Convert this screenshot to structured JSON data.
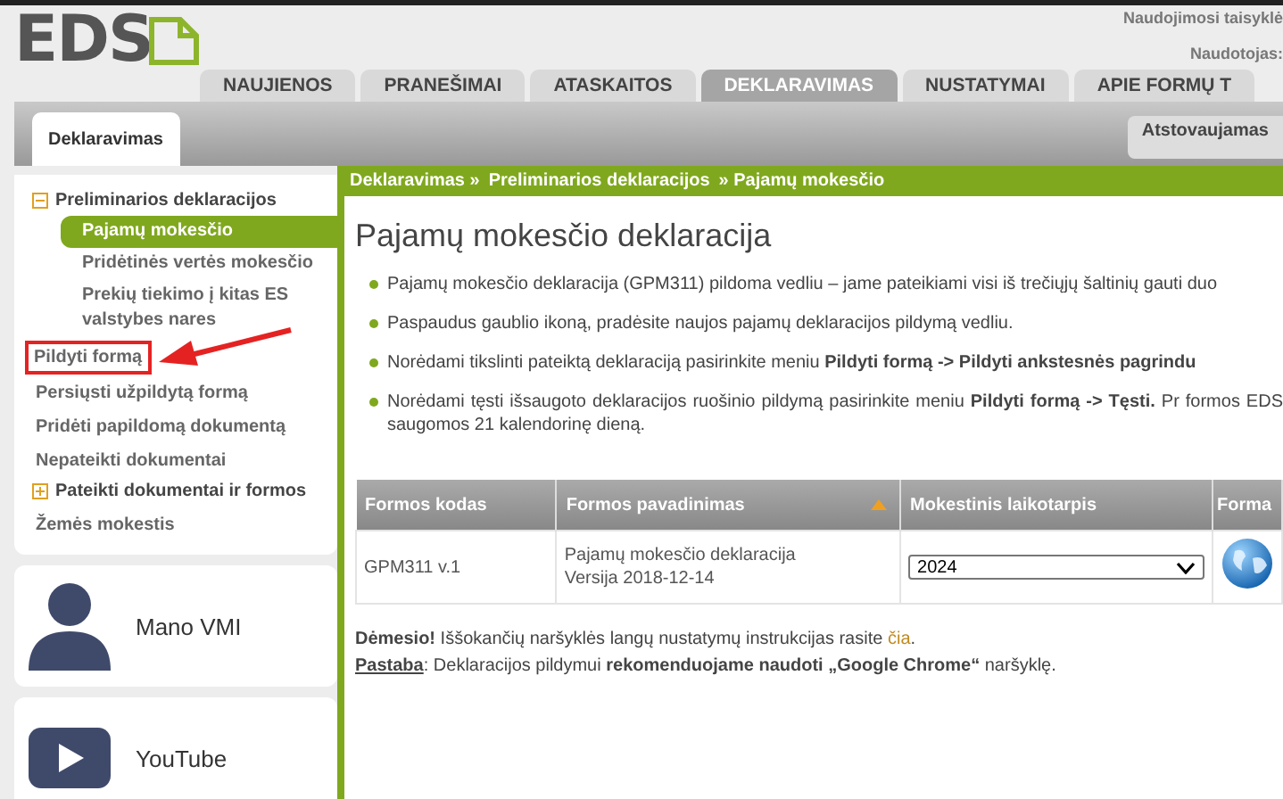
{
  "header": {
    "logo": "EDS",
    "links": [
      "Naudojimosi taisyklė",
      "Naudotojas:"
    ]
  },
  "tabs": [
    {
      "label": "NAUJIENOS",
      "selected": false
    },
    {
      "label": "PRANEŠIMAI",
      "selected": false
    },
    {
      "label": "ATASKAITOS",
      "selected": false
    },
    {
      "label": "DEKLARAVIMAS",
      "selected": true
    },
    {
      "label": "NUSTATYMAI",
      "selected": false
    },
    {
      "label": "APIE FORMŲ T",
      "selected": false
    }
  ],
  "subtabs": [
    {
      "label": "Deklaravimas",
      "selected": true
    }
  ],
  "represented": "Atstovaujamas",
  "sidebar": {
    "items": [
      {
        "label": "Preliminarios deklaracijos",
        "kind": "group",
        "expanded": true,
        "children": [
          {
            "label": "Pajamų mokesčio",
            "selected": true
          },
          {
            "label": "Pridėtinės vertės mokesčio",
            "selected": false
          },
          {
            "label": "Prekių tiekimo į kitas ES valstybes nares",
            "selected": false
          }
        ]
      },
      {
        "label": "Pildyti formą",
        "kind": "item",
        "annotated": true
      },
      {
        "label": "Persiųsti užpildytą formą",
        "kind": "item",
        "annotated": false
      },
      {
        "label": "Pridėti papildomą dokumentą",
        "kind": "item",
        "annotated": false
      },
      {
        "label": "Nepateikti dokumentai",
        "kind": "item",
        "annotated": false
      },
      {
        "label": "Pateikti dokumentai ir formos",
        "kind": "group",
        "expanded": false
      },
      {
        "label": "Žemės mokestis",
        "kind": "item",
        "annotated": false
      }
    ],
    "cards": [
      {
        "label": "Mano VMI",
        "kind": "person"
      },
      {
        "label": "YouTube",
        "kind": "video"
      }
    ]
  },
  "breadcrumb": [
    "Deklaravimas »",
    "Preliminarios deklaracijos",
    "» Pajamų mokesčio"
  ],
  "title": "Pajamų mokesčio deklaracija",
  "bullets": [
    "Pajamų mokesčio deklaracija (GPM311) pildoma vedliu – jame pateikiami visi iš trečiųjų šaltinių gauti duo",
    "Paspaudus gaublio ikoną, pradėsite naujos pajamų deklaracijos pildymą vedliu.",
    "Norėdami tikslinti pateiktą deklaraciją pasirinkite meniu **Pildyti formą -> Pildyti ankstesnės pagrindu**",
    "Norėdami tęsti išsaugoto deklaracijos ruošinio pildymą pasirinkite meniu **Pildyti formą -> Tęsti.** Pr formos EDS saugomos 21 kalendorinę dieną."
  ],
  "table": {
    "columns": [
      {
        "label": "Formos kodas",
        "sorted": false
      },
      {
        "label": "Formos pavadinimas",
        "sorted": true
      },
      {
        "label": "Mokestinis laikotarpis",
        "sorted": false
      },
      {
        "label": "Forma",
        "sorted": false
      }
    ],
    "rows": [
      {
        "code": "GPM311 v.1",
        "name": "Pajamų mokesčio deklaracija",
        "version": "Versija 2018-12-14",
        "period": "2024"
      }
    ]
  },
  "notes": [
    {
      "label": "Dėmesio!",
      "text": "Iššokančių naršyklės langų nustatymų instrukcijas rasite",
      "link": "čia",
      "end": "."
    },
    {
      "label": "Pastaba",
      "text": ": Deklaracijos pildymui **rekomenduojame naudoti „Google Chrome“** naršyklę."
    }
  ]
}
